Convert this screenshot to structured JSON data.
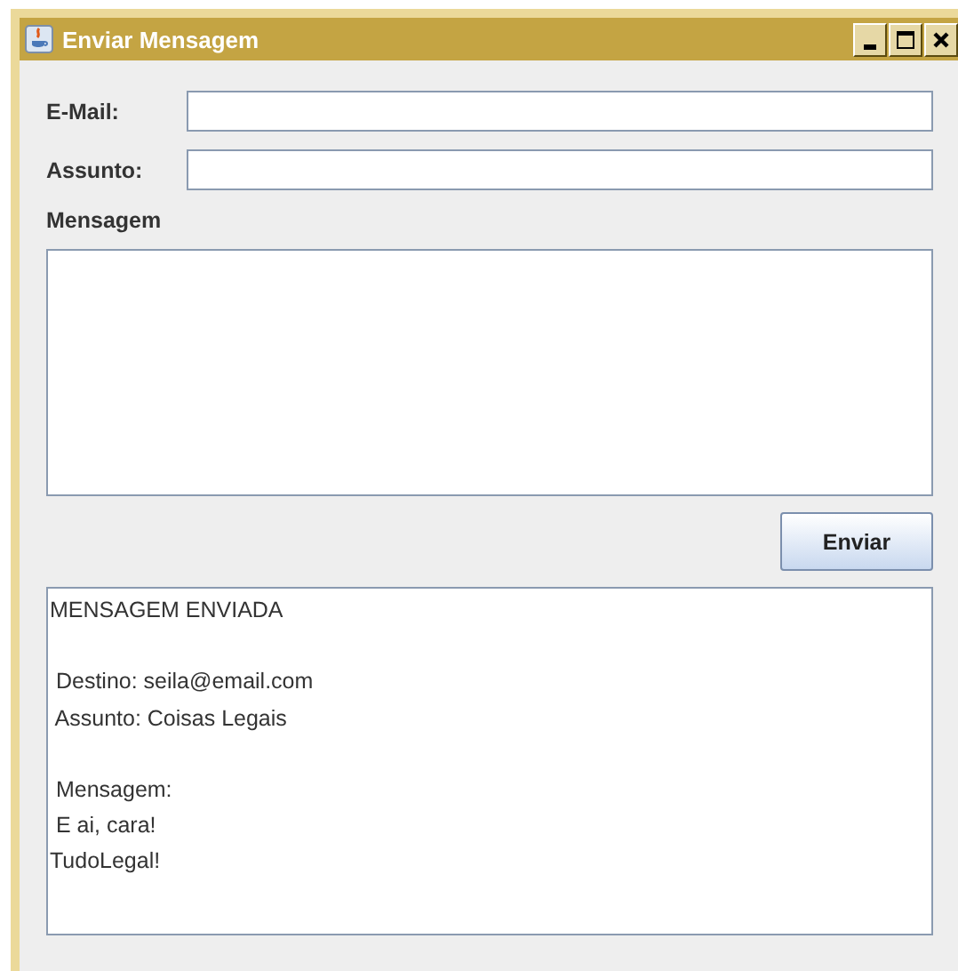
{
  "window": {
    "title": "Enviar Mensagem"
  },
  "fields": [
    {
      "label": "E-Mail:"
    },
    {
      "label": "Assunto:"
    }
  ],
  "message": {
    "label": "Mensagem"
  },
  "send_button": {
    "label": "Enviar"
  },
  "output": {
    "text": "MENSAGEM ENVIADA\n\n Destino: seila@email.com\n Assunto: Coisas Legais\n\n Mensagem:\n E ai, cara!\nTudoLegal!"
  }
}
